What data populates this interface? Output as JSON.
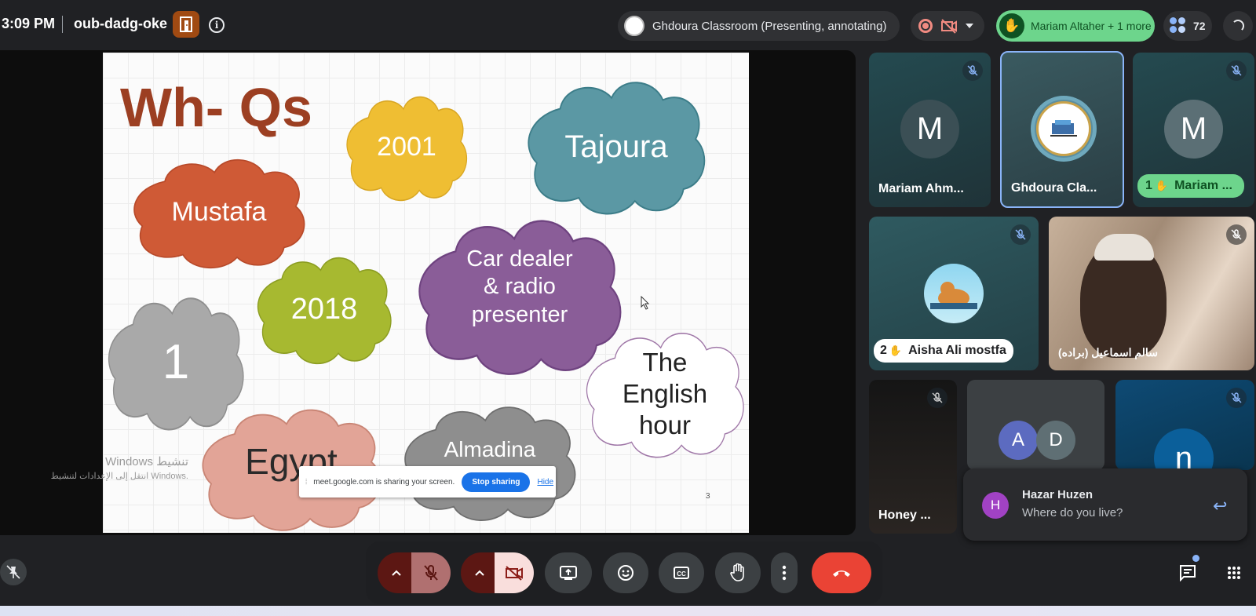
{
  "meeting": {
    "time": "3:09 PM",
    "code": "oub-dadg-oke",
    "info_icon": "i"
  },
  "presenting": {
    "label": "Ghdoura Classroom (Presenting, annotating)"
  },
  "raised_hands": {
    "label": "Mariam Altaher + 1 more"
  },
  "people": {
    "count": "72"
  },
  "slide": {
    "title": "Wh- Qs",
    "number": "3",
    "clouds": [
      {
        "text": "Mustafa",
        "color": "#cf5a36"
      },
      {
        "text": "2001",
        "color": "#efbe33"
      },
      {
        "text": "Tajoura",
        "color": "#5b98a4"
      },
      {
        "text": "2018",
        "color": "#a7b930"
      },
      {
        "text": "Car dealer\n& radio\npresenter",
        "color": "#8a5d98"
      },
      {
        "text": "1",
        "color": "#a9a9a9"
      },
      {
        "text": "The\nEnglish\nhour",
        "color": "#ffffff"
      },
      {
        "text": "Egypt",
        "color": "#e2a497"
      },
      {
        "text": "Almadina",
        "color": "#8e8e8e"
      }
    ]
  },
  "watermark": {
    "line1": "Windows تنشيط",
    "line2": "انتقل إلى الإعدادات لتنشيط Windows."
  },
  "share_banner": {
    "text": "meet.google.com is sharing your screen.",
    "stop_label": "Stop sharing",
    "hide_label": "Hide"
  },
  "tiles": [
    {
      "name": "Mariam Ahm...",
      "initial": "M"
    },
    {
      "name": "Ghdoura Cla..."
    },
    {
      "name": "Mariam ...",
      "initial": "M",
      "hand_count": "1"
    },
    {
      "name": "Aisha Ali mostfa",
      "hand_count": "2"
    },
    {
      "name": "سالم اسماعيل (براده)"
    },
    {
      "name": "Honey ..."
    },
    {
      "initials": [
        "A",
        "D"
      ]
    },
    {
      "initial": "n"
    }
  ],
  "chat_toast": {
    "avatar": "H",
    "name": "Hazar Huzen",
    "message": "Where do you live?"
  },
  "colors": {
    "accent_green": "#6dd58c",
    "end_call": "#ea4335",
    "muted_bg": "#8c1d18"
  }
}
